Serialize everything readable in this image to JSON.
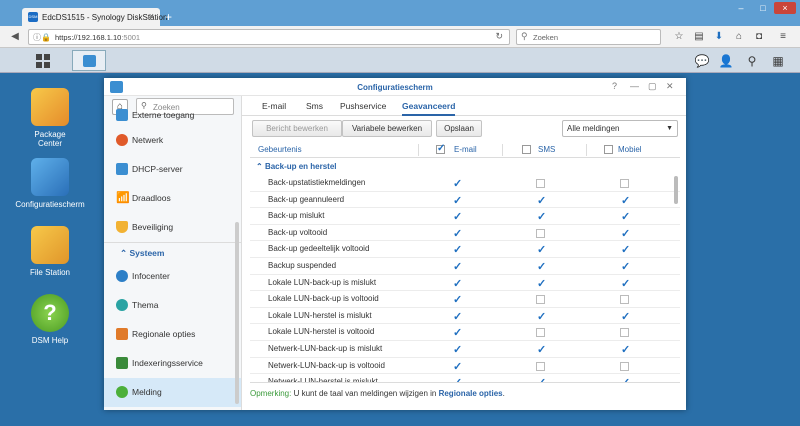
{
  "browser": {
    "tab_title": "EdcDS1515 - Synology DiskStation",
    "url_host": "https://192.168.1.10",
    "url_port": ":5001",
    "search_placeholder": "Zoeken",
    "favicon_text": "DSM"
  },
  "desktop": {
    "icons": [
      {
        "label": "Package\nCenter",
        "color": "#f2b233"
      },
      {
        "label": "Configuratiescherm",
        "color": "#3b8ed1"
      },
      {
        "label": "File Station",
        "color": "#f2a833"
      },
      {
        "label": "DSM Help",
        "color": "#6fbf3a"
      }
    ]
  },
  "window": {
    "title": "Configuratiescherm",
    "search_placeholder": "Zoeken",
    "sidebar": {
      "items_top": [
        {
          "label": "Externe toegang",
          "color": "#3b8ed1"
        },
        {
          "label": "Netwerk",
          "color": "#e05a2a"
        },
        {
          "label": "DHCP-server",
          "color": "#3b8ed1"
        },
        {
          "label": "Draadloos",
          "color": "#2d7fc7"
        },
        {
          "label": "Beveiliging",
          "color": "#f2b233"
        }
      ],
      "group_label": "Systeem",
      "items_system": [
        {
          "label": "Infocenter",
          "color": "#2d7fc7"
        },
        {
          "label": "Thema",
          "color": "#2aa3a3"
        },
        {
          "label": "Regionale opties",
          "color": "#e07a2a"
        },
        {
          "label": "Indexeringsservice",
          "color": "#3a8a3a"
        },
        {
          "label": "Melding",
          "color": "#4caf3a"
        }
      ]
    },
    "tabs": [
      "E-mail",
      "Sms",
      "Pushservice",
      "Geavanceerd"
    ],
    "active_tab": "Geavanceerd",
    "buttons": {
      "edit_message": "Bericht bewerken",
      "edit_variable": "Variabele bewerken",
      "save": "Opslaan"
    },
    "filter": {
      "selected": "Alle meldingen"
    },
    "columns": {
      "event": "Gebeurtenis",
      "email": "E-mail",
      "sms": "SMS",
      "mobile": "Mobiel"
    },
    "group_title": "Back-up en herstel",
    "rows": [
      {
        "name": "Back-upstatistiekmeldingen",
        "email": true,
        "sms": false,
        "mobile": false
      },
      {
        "name": "Back-up geannuleerd",
        "email": true,
        "sms": true,
        "mobile": true
      },
      {
        "name": "Back-up mislukt",
        "email": true,
        "sms": true,
        "mobile": true
      },
      {
        "name": "Back-up voltooid",
        "email": true,
        "sms": false,
        "mobile": true
      },
      {
        "name": "Back-up gedeeltelijk voltooid",
        "email": true,
        "sms": true,
        "mobile": true
      },
      {
        "name": "Backup suspended",
        "email": true,
        "sms": true,
        "mobile": true
      },
      {
        "name": "Lokale LUN-back-up is mislukt",
        "email": true,
        "sms": true,
        "mobile": true
      },
      {
        "name": "Lokale LUN-back-up is voltooid",
        "email": true,
        "sms": false,
        "mobile": false
      },
      {
        "name": "Lokale LUN-herstel is mislukt",
        "email": true,
        "sms": true,
        "mobile": true
      },
      {
        "name": "Lokale LUN-herstel is voltooid",
        "email": true,
        "sms": false,
        "mobile": false
      },
      {
        "name": "Netwerk-LUN-back-up is mislukt",
        "email": true,
        "sms": true,
        "mobile": true
      },
      {
        "name": "Netwerk-LUN-back-up is voltooid",
        "email": true,
        "sms": false,
        "mobile": false
      },
      {
        "name": "Netwerk-LUN-herstel is mislukt",
        "email": true,
        "sms": true,
        "mobile": true
      }
    ],
    "note": {
      "label": "Opmerking:",
      "text": "U kunt de taal van meldingen wijzigen in",
      "link": "Regionale opties",
      "end": "."
    }
  }
}
